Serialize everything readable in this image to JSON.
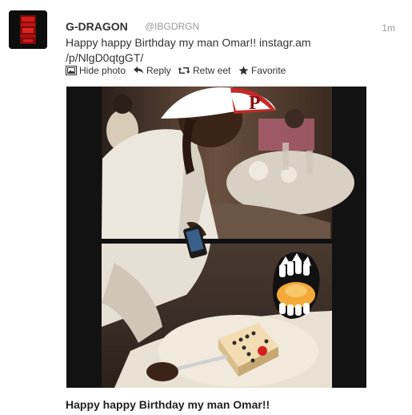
{
  "tweet": {
    "display_name": "G-DRAGON",
    "screen_name": "@IBGDRGN",
    "timestamp": "1m",
    "text_line1": "Happy happy Birthday my man Omar!! instagr.am",
    "text_line2": "/p/NlgD0qtgGT/"
  },
  "actions": {
    "hide_photo": "Hide photo",
    "reply": "Reply",
    "retweet": "Retw eet",
    "favorite": "Favorite"
  },
  "media": {
    "cap_letter": "P",
    "caption": "Happy happy Birthday my man Omar!!"
  },
  "colors": {
    "avatar_red": "#d41a1a",
    "cap_red": "#c62828",
    "cake_candle": "#d62020"
  }
}
